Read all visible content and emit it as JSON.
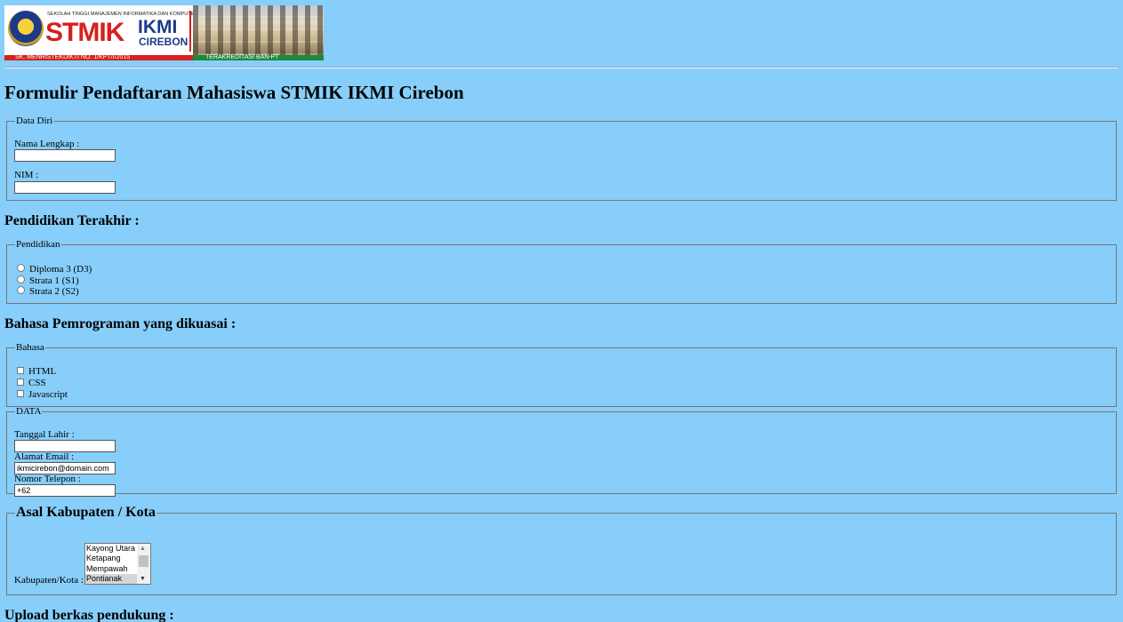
{
  "banner": {
    "tagline": "SEKOLAH TINGGI MANAJEMEN INFORMATIKA DAN KOMPUTER",
    "brand_main": "STMIK",
    "brand_ikmi": "IKMI",
    "brand_city": "CIREBON",
    "decree": "SK. MENRISTEKDIKTI NO. 1/KPT/I/2015",
    "accreditation": "TERAKREDITASI BAN-PT"
  },
  "page_title": "Formulir Pendaftaran Mahasiswa STMIK IKMI Cirebon",
  "data_diri": {
    "legend": "Data Diri",
    "nama_label": "Nama Lengkap :",
    "nama_value": "",
    "nim_label": "NIM :",
    "nim_value": ""
  },
  "pendidikan_heading": "Pendidikan Terakhir :",
  "pendidikan": {
    "legend": "Pendidikan",
    "options": [
      "Diploma 3 (D3)",
      "Strata 1 (S1)",
      "Strata 2 (S2)"
    ]
  },
  "bahasa_heading": "Bahasa Pemrograman yang dikuasai :",
  "bahasa": {
    "legend": "Bahasa",
    "options": [
      "HTML",
      "CSS",
      "Javascript"
    ]
  },
  "data": {
    "legend": "DATA",
    "tgl_label": "Tanggal Lahir :",
    "tgl_value": "",
    "email_label": "Alamat Email :",
    "email_value": "ikmicirebon@domain.com",
    "telp_label": "Nomor Telepon :",
    "telp_value": "+62"
  },
  "asal": {
    "legend": "Asal Kabupaten / Kota",
    "label": "Kabupaten/Kota :",
    "options": [
      "Kayong Utara",
      "Ketapang",
      "Mempawah",
      "Pontianak"
    ],
    "selected": "Pontianak"
  },
  "upload_heading": "Upload berkas pendukung :"
}
